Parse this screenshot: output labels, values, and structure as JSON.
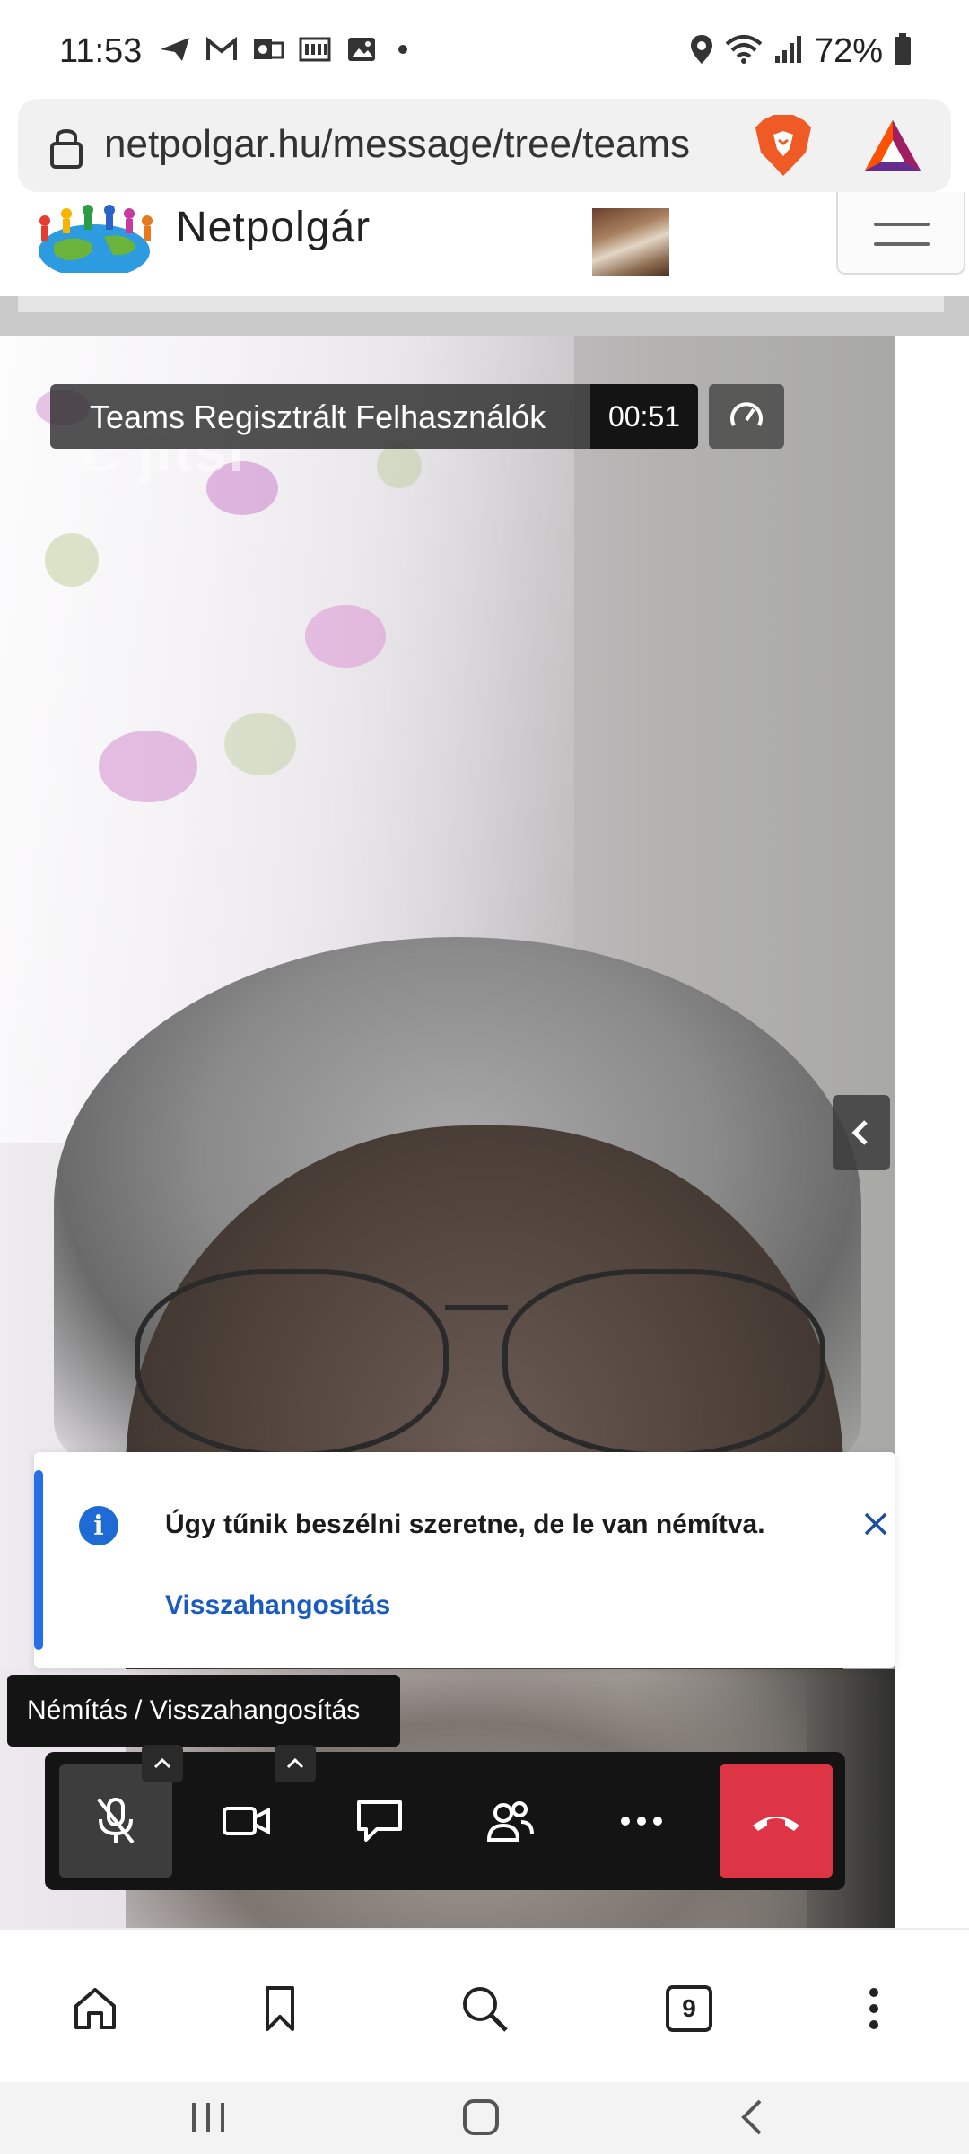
{
  "status_bar": {
    "time": "11:53",
    "battery": "72%",
    "icons": [
      "send-icon",
      "gmail-icon",
      "outlook-icon",
      "calendar-icon",
      "gallery-icon",
      "location-icon",
      "wifi-icon",
      "signal-icon",
      "battery-icon"
    ]
  },
  "browser": {
    "url": "netpolgar.hu/message/tree/teams",
    "extensions": [
      "brave-lion-icon",
      "bat-triangle-icon"
    ]
  },
  "site": {
    "name": "Netpolgár",
    "menu_label": "menu"
  },
  "meeting": {
    "title": "Teams Regisztrált Felhasználók",
    "timer": "00:51",
    "watermark": "jitsi"
  },
  "notification": {
    "message": "Úgy tűnik beszélni szeretne, de le van némítva.",
    "action": "Visszahangosítás"
  },
  "tooltip": {
    "text": "Némítás / Visszahangosítás"
  },
  "toolbar": {
    "buttons": [
      "mic-muted-icon",
      "camera-icon",
      "chat-icon",
      "participants-icon",
      "more-icon",
      "hangup-icon"
    ]
  },
  "bottom_nav": {
    "tab_count": "9",
    "items": [
      "home-icon",
      "bookmark-icon",
      "search-icon",
      "tabs-icon",
      "more-vert-icon"
    ]
  },
  "colors": {
    "hangup": "#dd3545",
    "notice_accent": "#246fe5",
    "link": "#1a5bbf"
  }
}
